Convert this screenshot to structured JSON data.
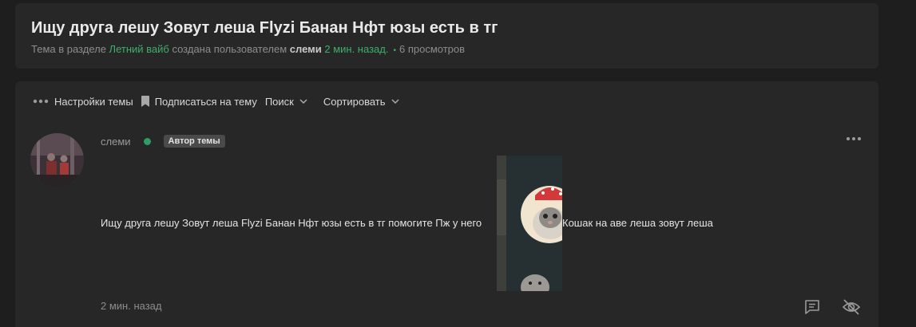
{
  "thread": {
    "title": "Ищу друга лешу Зовут леша Flyzi Банан Нфт юзы есть в тг",
    "meta_prefix": "Тема в разделе ",
    "section": "Летний вайб",
    "meta_middle": " создана пользователем ",
    "author": "слеми",
    "time_ago": " 2 мин. назад.",
    "views": "6 просмотров"
  },
  "toolbar": {
    "settings_label": "Настройки темы",
    "subscribe_label": "Подписаться на тему",
    "search_label": "Поиск",
    "sort_label": "Сортировать"
  },
  "post": {
    "author": "слеми",
    "badge": "Автор темы",
    "text_before": "Ищу друга лешу Зовут леша Flyzi Банан Нфт юзы есть в тг помогите Пж у него",
    "text_after": "Кошак на аве леша зовут леша",
    "time": "2 мин. назад"
  },
  "icons": {
    "settings": "more-horizontal-icon",
    "subscribe": "bookmark-icon",
    "reply": "comment-icon",
    "hide": "eye-off-icon"
  },
  "colors": {
    "accent": "#3fae6a",
    "background": "#1e1e1e",
    "card": "#272727",
    "online": "#2e9c63"
  }
}
